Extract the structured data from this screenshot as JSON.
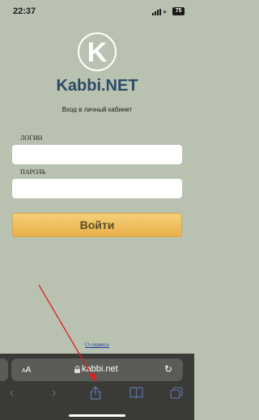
{
  "status": {
    "time": "22:37",
    "battery": "75"
  },
  "logo": {
    "letter": "K"
  },
  "brand": "Kabbi.NET",
  "subtitle": "Вход в личный кабинет",
  "login": {
    "label": "ЛОГИН",
    "value": ""
  },
  "password": {
    "label": "ПАРОЛЬ",
    "value": ""
  },
  "submit_label": "Войти",
  "about_link": "О сервисе",
  "browser": {
    "text_size_label": "AA",
    "domain": "kabbi.net"
  },
  "icons": [
    "signal-icon",
    "wifi-icon",
    "battery-icon",
    "lock-icon",
    "reload-icon",
    "back-icon",
    "forward-icon",
    "share-icon",
    "bookmarks-icon",
    "tabs-icon"
  ],
  "colors": {
    "background": "#b9c2b0",
    "brand": "#2c4a66",
    "button": "#efc063",
    "link": "#1a3aa8",
    "annotation_arrow": "#e02020"
  }
}
